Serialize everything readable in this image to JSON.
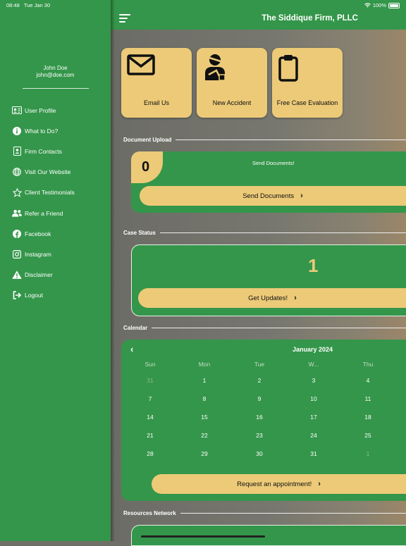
{
  "status_bar": {
    "time": "08:48",
    "date": "Tue Jan 30",
    "battery": "100%"
  },
  "user": {
    "name": "John Doe",
    "email": "john@doe.com"
  },
  "menu": [
    {
      "label": "User Profile",
      "icon": "id-card-icon"
    },
    {
      "label": "What to Do?",
      "icon": "info-icon"
    },
    {
      "label": "Firm Contacts",
      "icon": "contact-book-icon"
    },
    {
      "label": "Visit Our Website",
      "icon": "globe-icon"
    },
    {
      "label": "Client Testimonials",
      "icon": "star-icon"
    },
    {
      "label": "Refer a Friend",
      "icon": "users-icon"
    },
    {
      "label": "Facebook",
      "icon": "facebook-icon"
    },
    {
      "label": "Instagram",
      "icon": "instagram-icon"
    },
    {
      "label": "Disclaimer",
      "icon": "warning-icon"
    },
    {
      "label": "Logout",
      "icon": "logout-icon"
    }
  ],
  "app_title": "The Siddique Firm, PLLC",
  "quick_actions": [
    {
      "label": "Email Us",
      "icon": "envelope-icon"
    },
    {
      "label": "New Accident",
      "icon": "injured-person-icon"
    },
    {
      "label": "Free Case Evaluation",
      "icon": "clipboard-icon"
    }
  ],
  "document_upload": {
    "section_title": "Document Upload",
    "count": "0",
    "message": "Send Documents!",
    "button_label": "Send Documents"
  },
  "case_status": {
    "section_title": "Case Status",
    "count": "1",
    "button_label": "Get Updates!"
  },
  "calendar": {
    "section_title": "Calendar",
    "month": "January 2024",
    "weekdays": [
      "Sun",
      "Mon",
      "Tue",
      "W...",
      "Thu"
    ],
    "weeks": [
      [
        "31",
        "1",
        "2",
        "3",
        "4"
      ],
      [
        "7",
        "8",
        "9",
        "10",
        "11"
      ],
      [
        "14",
        "15",
        "16",
        "17",
        "18"
      ],
      [
        "21",
        "22",
        "23",
        "24",
        "25"
      ],
      [
        "28",
        "29",
        "30",
        "31",
        "1"
      ]
    ],
    "button_label": "Request an appointment!"
  },
  "resources": {
    "section_title": "Resources Network"
  },
  "colors": {
    "green": "#34964a",
    "gold": "#ecca78",
    "muted_day": "#8fb894"
  }
}
